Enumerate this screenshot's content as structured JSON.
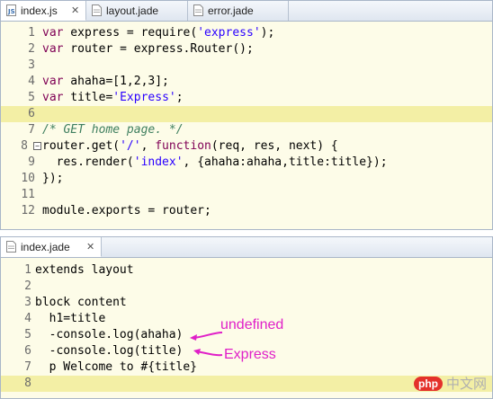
{
  "top_tabs": [
    {
      "label": "index.js",
      "active": true,
      "close": "✕"
    },
    {
      "label": "layout.jade",
      "active": false
    },
    {
      "label": "error.jade",
      "active": false
    }
  ],
  "top_code": [
    {
      "n": "1",
      "text": "var express = require('express');"
    },
    {
      "n": "2",
      "text": "var router = express.Router();"
    },
    {
      "n": "3",
      "text": ""
    },
    {
      "n": "4",
      "text": "var ahaha=[1,2,3];"
    },
    {
      "n": "5",
      "text": "var title='Express';"
    },
    {
      "n": "6",
      "text": ""
    },
    {
      "n": "7",
      "text": "/* GET home page. */"
    },
    {
      "n": "8",
      "text": "router.get('/', function(req, res, next) {"
    },
    {
      "n": "9",
      "text": "  res.render('index', {ahaha:ahaha,title:title});"
    },
    {
      "n": "10",
      "text": "});"
    },
    {
      "n": "11",
      "text": ""
    },
    {
      "n": "12",
      "text": "module.exports = router;"
    }
  ],
  "bottom_tab": {
    "label": "index.jade",
    "close": "✕"
  },
  "bottom_code": [
    {
      "n": "1",
      "text": "extends layout"
    },
    {
      "n": "2",
      "text": ""
    },
    {
      "n": "3",
      "text": "block content"
    },
    {
      "n": "4",
      "text": "  h1=title"
    },
    {
      "n": "5",
      "text": "  -console.log(ahaha)"
    },
    {
      "n": "6",
      "text": "  -console.log(title)"
    },
    {
      "n": "7",
      "text": "  p Welcome to #{title}"
    },
    {
      "n": "8",
      "text": ""
    }
  ],
  "annotations": {
    "undefined_label": "undefined",
    "express_label": "Express",
    "color": "#e020c8"
  },
  "watermark": {
    "logo": "php",
    "text": "中文网"
  },
  "colors": {
    "editor_bg": "#fdfce8",
    "current_line": "#f3efa5",
    "keyword": "#7f0055",
    "string": "#2a00ff",
    "comment": "#3f7f5f"
  }
}
